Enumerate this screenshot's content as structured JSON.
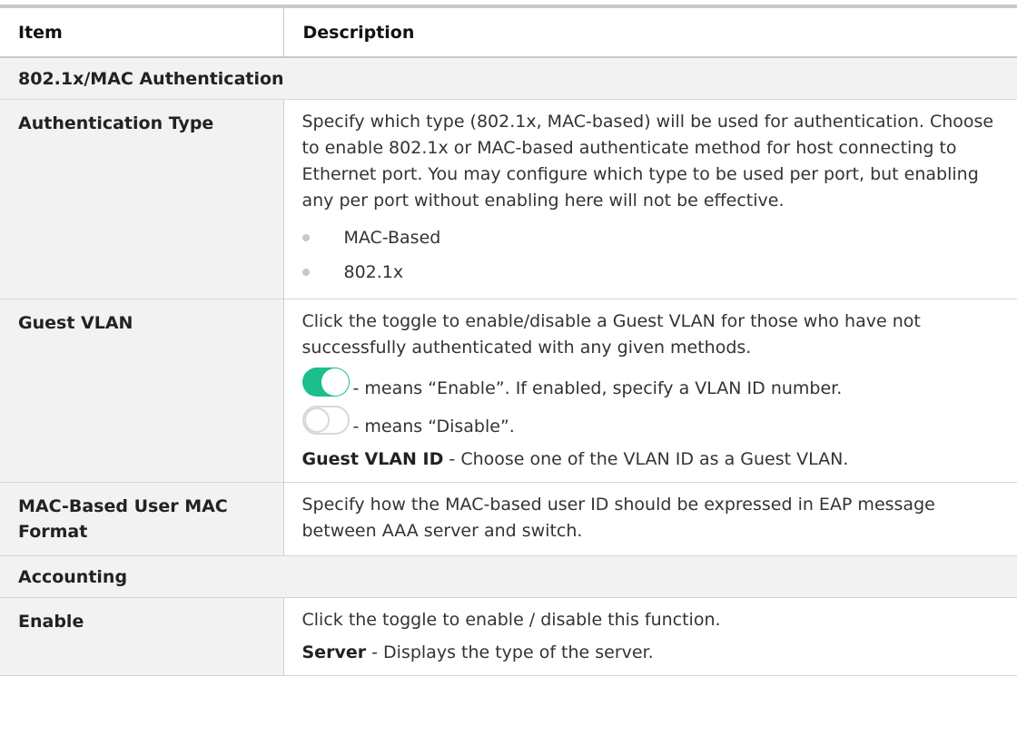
{
  "header": {
    "item": "Item",
    "description": "Description"
  },
  "sections": {
    "auth": "802.1x/MAC Authentication",
    "accounting": "Accounting"
  },
  "rows": {
    "auth_type": {
      "item": "Authentication Type",
      "desc": "Specify which type (802.1x, MAC-based) will be used for authentication. Choose to enable 802.1x or MAC-based authenticate method for host connecting to Ethernet port. You may configure which type to be used per port, but enabling any per port without enabling here will not be effective.",
      "bullets": [
        "MAC-Based",
        "802.1x"
      ]
    },
    "guest_vlan": {
      "item": "Guest VLAN",
      "desc": "Click the toggle to enable/disable a Guest VLAN for those who have not successfully authenticated with any given methods.",
      "toggle_on_text": "- means “Enable”. If enabled, specify a VLAN ID number.",
      "toggle_off_text": "- means “Disable”.",
      "id_label": "Guest VLAN ID",
      "id_text": " - Choose one of the VLAN ID as a Guest VLAN."
    },
    "mac_format": {
      "item_line1": "MAC-Based User MAC",
      "item_line2": "Format",
      "desc": "Specify how the MAC-based user ID should be expressed in EAP message between AAA server and switch."
    },
    "enable": {
      "item": "Enable",
      "desc": "Click the toggle to enable / disable this function.",
      "server_label": "Server",
      "server_text": " - Displays the type of the server."
    }
  },
  "colors": {
    "toggle_on": "#1bbf8b",
    "section_bg": "#f2f2f2"
  },
  "icons": {
    "toggle_on": "toggle-on-icon",
    "toggle_off": "toggle-off-icon",
    "bullet": "bullet-dot-icon"
  }
}
